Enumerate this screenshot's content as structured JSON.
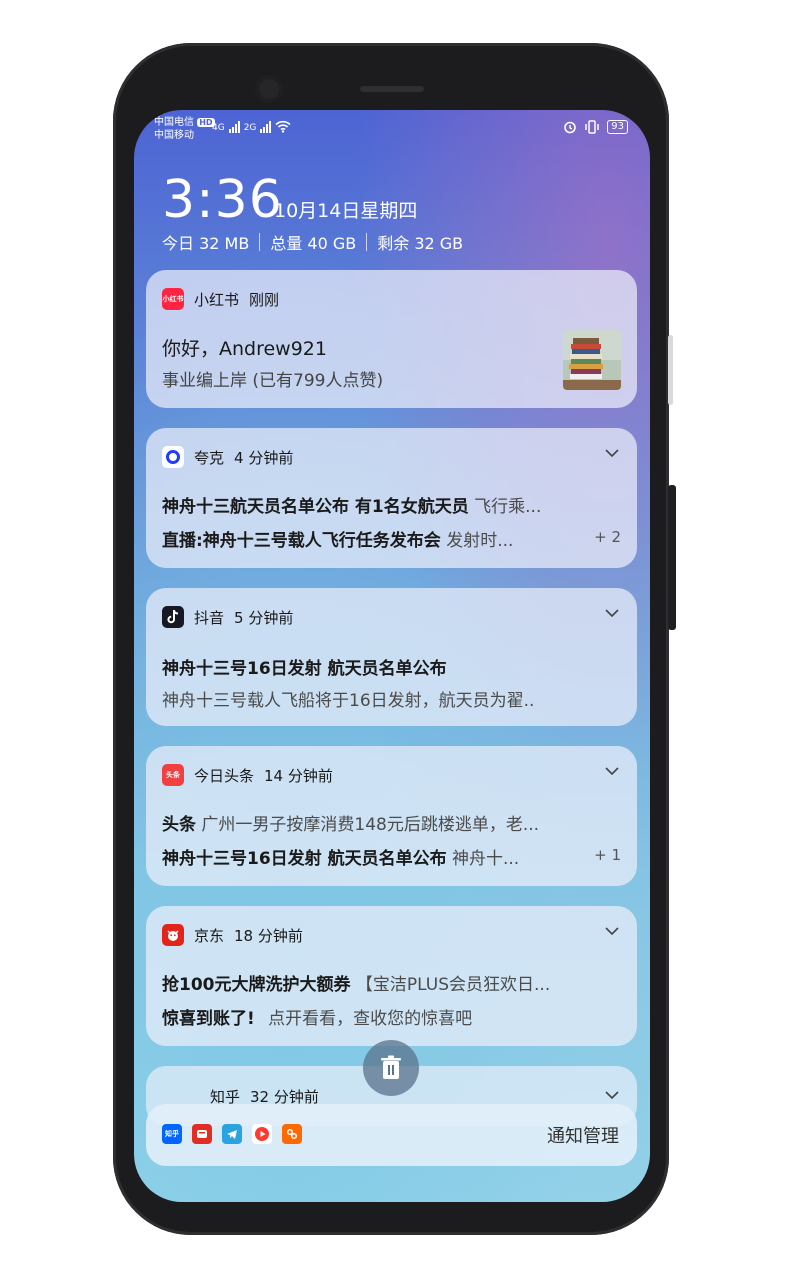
{
  "status_bar": {
    "carrier1": "中国电信",
    "carrier2": "中国移动",
    "hd": "HD",
    "net1": "4G",
    "net2": "2G",
    "battery": "93"
  },
  "lockscreen": {
    "time": "3:36",
    "date": "10月14日星期四",
    "storage": [
      "今日 32 MB",
      "总量 40 GB",
      "剩余 32 GB"
    ]
  },
  "notifications": [
    {
      "app": "小红书",
      "time": "刚刚",
      "icon": "xiaohongshu-icon",
      "color": "#ff2442",
      "icon_text": "小红书",
      "title": "你好，Andrew921",
      "body": "事业编上岸 (已有799人点赞)"
    },
    {
      "app": "夸克",
      "time": "4 分钟前",
      "icon": "quark-icon",
      "color": "#1f3cff",
      "lines": [
        {
          "bold": "神舟十三航天员名单公布 有1名女航天员",
          "muted": "飞行乘..."
        },
        {
          "bold": "直播:神舟十三号载人飞行任务发布会",
          "muted": "发射时..."
        }
      ],
      "more": "+ 2"
    },
    {
      "app": "抖音",
      "time": "5 分钟前",
      "icon": "douyin-icon",
      "color": "#161823",
      "title": "神舟十三号16日发射 航天员名单公布",
      "body": "神舟十三号载人飞船将于16日发射，航天员为翟.."
    },
    {
      "app": "今日头条",
      "time": "14 分钟前",
      "icon": "toutiao-icon",
      "color": "#f04142",
      "icon_text": "头条",
      "lines": [
        {
          "bold": "头条",
          "muted": "广州一男子按摩消费148元后跳楼逃单，老..."
        },
        {
          "bold": "神舟十三号16日发射 航天员名单公布",
          "muted": "神舟十..."
        }
      ],
      "more": "+ 1"
    },
    {
      "app": "京东",
      "time": "18 分钟前",
      "icon": "jd-icon",
      "color": "#e1251b",
      "lines": [
        {
          "bold": "抢100元大牌洗护大额券",
          "muted": "【宝洁PLUS会员狂欢日..."
        },
        {
          "bold": "惊喜到账了!",
          "muted": "点开看看，查收您的惊喜吧"
        }
      ]
    },
    {
      "app": "知乎",
      "time": "32 分钟前",
      "icon": "zhihu-icon",
      "color": "#0066ff"
    }
  ],
  "footer": {
    "manage_label": "通知管理",
    "icons": [
      {
        "name": "zhihu-icon",
        "color": "#0066ff",
        "text": "知乎"
      },
      {
        "name": "pinduoduo-icon",
        "color": "#e02e24",
        "text": ""
      },
      {
        "name": "telegram-icon",
        "color": "#2aa3e0",
        "text": ""
      },
      {
        "name": "video-app-icon",
        "color": "#ff3b30",
        "text": ""
      },
      {
        "name": "orange-app-icon",
        "color": "#ff6a00",
        "text": ""
      }
    ]
  }
}
